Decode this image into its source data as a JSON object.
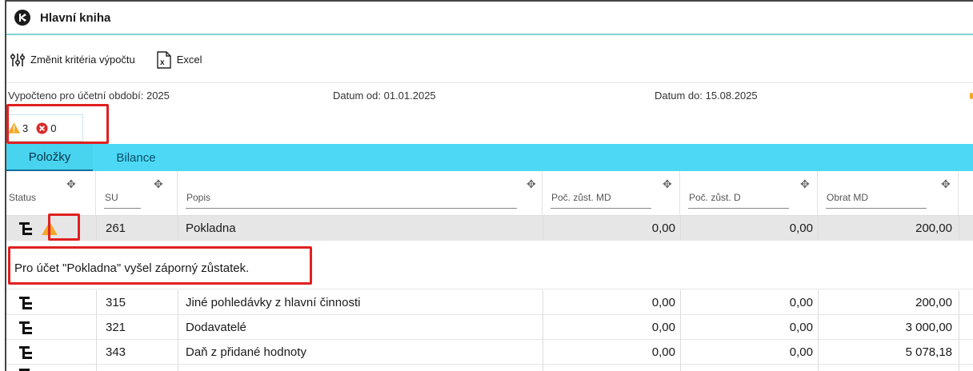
{
  "window": {
    "title": "Hlavní kniha"
  },
  "toolbar": {
    "criteria_label": "Změnit kritéria výpočtu",
    "excel_label": "Excel"
  },
  "info": {
    "period": "Vypočteno pro účetní období: 2025",
    "date_from": "Datum od: 01.01.2025",
    "date_to": "Datum do: 15.08.2025"
  },
  "badges": {
    "warnings": "3",
    "errors": "0"
  },
  "tabs": [
    {
      "label": "Položky",
      "active": true
    },
    {
      "label": "Bilance",
      "active": false
    }
  ],
  "columns": {
    "status": "Status",
    "su": "SU",
    "popis": "Popis",
    "poc_md": "Poč. zůst. MD",
    "poc_d": "Poč. zůst. D",
    "obrat_md": "Obrat MD"
  },
  "rows": [
    {
      "su": "261",
      "popis": "Pokladna",
      "poc_md": "0,00",
      "poc_d": "0,00",
      "obrat_md": "200,00"
    },
    {
      "su": "315",
      "popis": "Jiné pohledávky z hlavní činnosti",
      "poc_md": "0,00",
      "poc_d": "0,00",
      "obrat_md": "200,00"
    },
    {
      "su": "321",
      "popis": "Dodavatelé",
      "poc_md": "0,00",
      "poc_d": "0,00",
      "obrat_md": "3 000,00"
    },
    {
      "su": "343",
      "popis": "Daň z přidané hodnoty",
      "poc_md": "0,00",
      "poc_d": "0,00",
      "obrat_md": "5 078,18"
    }
  ],
  "message": "Pro účet \"Pokladna\" vyšel záporný zůstatek.",
  "colors": {
    "accent_tab": "#4dd9f5",
    "warning": "#f5a623",
    "error": "#e02020",
    "highlight_box": "#e02020"
  }
}
